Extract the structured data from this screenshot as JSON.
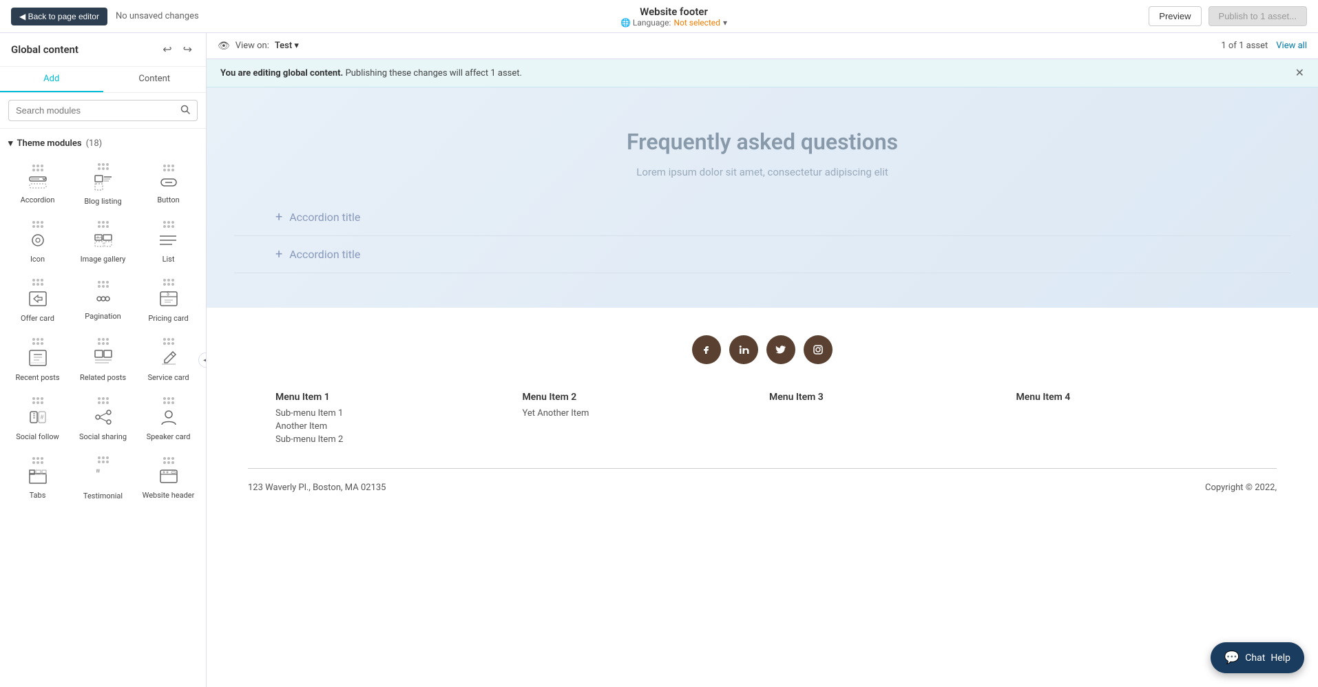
{
  "topbar": {
    "back_label": "◀ Back to page editor",
    "unsaved_label": "No unsaved changes",
    "page_title": "Website footer",
    "language_prefix": "🌐 Language:",
    "language_value": "Not selected",
    "preview_label": "Preview",
    "publish_label": "Publish to 1 asset..."
  },
  "viewbar": {
    "view_label": "View on:",
    "view_value": "Test",
    "asset_count": "1 of 1 asset",
    "view_all_label": "View all"
  },
  "infobanner": {
    "bold_text": "You are editing global content.",
    "rest_text": " Publishing these changes will affect 1 asset."
  },
  "sidebar": {
    "title": "Global content",
    "undo_icon": "↩",
    "redo_icon": "↪",
    "tab_add": "Add",
    "tab_content": "Content",
    "search_placeholder": "Search modules",
    "section_label": "Theme modules",
    "section_count": "(18)",
    "modules": [
      {
        "id": "accordion",
        "label": "Accordion",
        "icon": "accordion"
      },
      {
        "id": "blog-listing",
        "label": "Blog listing",
        "icon": "blog"
      },
      {
        "id": "button",
        "label": "Button",
        "icon": "button"
      },
      {
        "id": "icon",
        "label": "Icon",
        "icon": "icon"
      },
      {
        "id": "image-gallery",
        "label": "Image gallery",
        "icon": "image-gallery"
      },
      {
        "id": "list",
        "label": "List",
        "icon": "list"
      },
      {
        "id": "offer-card",
        "label": "Offer card",
        "icon": "offer-card"
      },
      {
        "id": "pagination",
        "label": "Pagination",
        "icon": "pagination"
      },
      {
        "id": "pricing-card",
        "label": "Pricing card",
        "icon": "pricing-card"
      },
      {
        "id": "recent-posts",
        "label": "Recent posts",
        "icon": "recent-posts"
      },
      {
        "id": "related-posts",
        "label": "Related posts",
        "icon": "related-posts"
      },
      {
        "id": "service-card",
        "label": "Service card",
        "icon": "service-card"
      },
      {
        "id": "social-follow",
        "label": "Social follow",
        "icon": "social-follow"
      },
      {
        "id": "social-sharing",
        "label": "Social sharing",
        "icon": "social-sharing"
      },
      {
        "id": "speaker-card",
        "label": "Speaker card",
        "icon": "speaker-card"
      },
      {
        "id": "tabs",
        "label": "Tabs",
        "icon": "tabs"
      },
      {
        "id": "testimonial",
        "label": "Testimonial",
        "icon": "testimonial"
      },
      {
        "id": "website-header",
        "label": "Website header",
        "icon": "website-header"
      }
    ]
  },
  "canvas": {
    "faq": {
      "title": "Frequently asked questions",
      "subtitle": "Lorem ipsum dolor sit amet, consectetur adipiscing elit",
      "accordions": [
        {
          "label": "Accordion title"
        },
        {
          "label": "Accordion title"
        }
      ]
    },
    "footer": {
      "social_links": [
        "facebook",
        "linkedin",
        "twitter",
        "instagram"
      ],
      "nav_columns": [
        {
          "heading": "Menu Item 1",
          "items": [
            "Sub-menu Item 1",
            "Another Item",
            "Sub-menu Item 2"
          ]
        },
        {
          "heading": "Menu Item 2",
          "items": [
            "Yet Another Item"
          ]
        },
        {
          "heading": "Menu Item 3",
          "items": []
        },
        {
          "heading": "Menu Item 4",
          "items": []
        }
      ],
      "address": "123 Waverly Pl., Boston, MA 02135",
      "copyright": "Copyright © 2022,"
    }
  },
  "chat": {
    "icon": "💬",
    "label": "Chat",
    "help_label": "Help"
  },
  "icons": {
    "accordion": "∨",
    "blog": "📋",
    "button": "▭",
    "icon": "◎",
    "image-gallery": "🖼",
    "list": "☰",
    "offer-card": "🎁",
    "pagination": "···",
    "pricing-card": "$",
    "recent-posts": "⊞",
    "related-posts": "⊟",
    "service-card": "✂",
    "social-follow": "#",
    "social-sharing": "#",
    "speaker-card": "👤",
    "tabs": "⊡",
    "testimonial": "❝",
    "website-header": "🔭"
  }
}
